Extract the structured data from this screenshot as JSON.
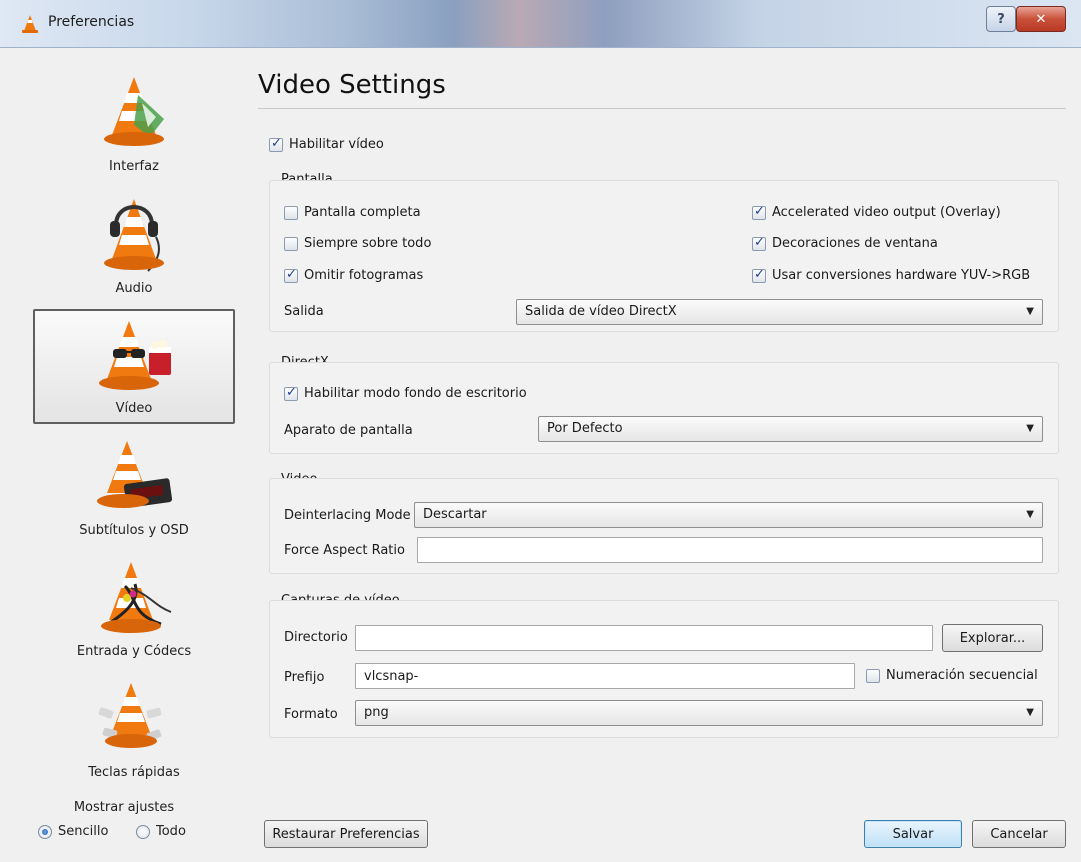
{
  "window": {
    "title": "Preferencias",
    "help_label": "?",
    "close_label": "✕"
  },
  "sidebar": {
    "items": [
      {
        "label": "Interfaz"
      },
      {
        "label": "Audio"
      },
      {
        "label": "Vídeo"
      },
      {
        "label": "Subtítulos y OSD"
      },
      {
        "label": "Entrada y Códecs"
      },
      {
        "label": "Teclas rápidas"
      }
    ],
    "selected": "Vídeo",
    "show_settings_label": "Mostrar ajustes",
    "simple_label": "Sencillo",
    "all_label": "Todo"
  },
  "main": {
    "title": "Video Settings",
    "enable_video": {
      "label": "Habilitar vídeo",
      "checked": true
    },
    "display": {
      "title": "Pantalla",
      "fullscreen": {
        "label": "Pantalla completa",
        "checked": false
      },
      "always_on_top": {
        "label": "Siempre sobre todo",
        "checked": false
      },
      "drop_frames": {
        "label": "Omitir fotogramas",
        "checked": true
      },
      "accelerated": {
        "label": "Accelerated video output (Overlay)",
        "checked": true
      },
      "window_decorations": {
        "label": "Decoraciones de ventana",
        "checked": true
      },
      "hw_yuv": {
        "label": "Usar conversiones hardware YUV->RGB",
        "checked": true
      },
      "output_label": "Salida",
      "output_value": "Salida de vídeo DirectX"
    },
    "directx": {
      "title": "DirectX",
      "wallpaper": {
        "label": "Habilitar modo fondo de escritorio",
        "checked": true
      },
      "device_label": "Aparato de pantalla",
      "device_value": "Por Defecto"
    },
    "video": {
      "title": "Video",
      "deinterlace_label": "Deinterlacing Mode",
      "deinterlace_value": "Descartar",
      "aspect_label": "Force Aspect Ratio",
      "aspect_value": ""
    },
    "snapshots": {
      "title": "Capturas de vídeo",
      "directory_label": "Directorio",
      "directory_value": "",
      "browse_label": "Explorar...",
      "prefix_label": "Prefijo",
      "prefix_value": "vlcsnap-",
      "sequential": {
        "label": "Numeración secuencial",
        "checked": false
      },
      "format_label": "Formato",
      "format_value": "png"
    }
  },
  "footer": {
    "reset_label": "Restaurar Preferencias",
    "save_label": "Salvar",
    "cancel_label": "Cancelar"
  },
  "colors": {
    "cone_orange": "#f07a10",
    "selected_border": "#5f5f5f",
    "primary_button": "#bfe0f6"
  }
}
